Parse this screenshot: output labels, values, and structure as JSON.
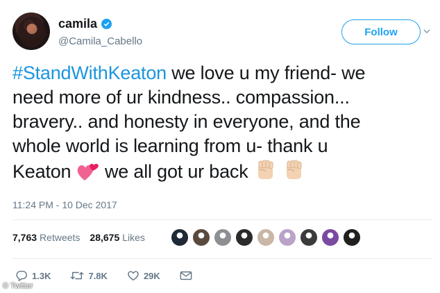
{
  "author": {
    "name": "camila",
    "handle": "@Camila_Cabello",
    "verified": true
  },
  "follow_button": {
    "label": "Follow"
  },
  "tweet": {
    "hashtag": "#StandWithKeaton",
    "line1_rest": " we love u my friend- we",
    "line2": "need more of ur kindness.. compassion...",
    "line3": "bravery.. and honesty in everyone, and the",
    "line4": "whole world is learning from u- thank u",
    "line5_a": "Keaton ",
    "line5_b": "we all got ur back",
    "emojis": [
      "two-hearts-emoji",
      "raised-fist-emoji",
      "raised-fist-emoji"
    ]
  },
  "timestamp": "11:24 PM - 10 Dec 2017",
  "stats": {
    "retweets_count": "7,763",
    "retweets_label": "Retweets",
    "likes_count": "28,675",
    "likes_label": "Likes"
  },
  "likers": [
    {
      "color": "#1f2a36"
    },
    {
      "color": "#5a4a3e"
    },
    {
      "color": "#8d8f92"
    },
    {
      "color": "#2b2b2b"
    },
    {
      "color": "#c9b6a6"
    },
    {
      "color": "#b9a3c9"
    },
    {
      "color": "#3b3b3b"
    },
    {
      "color": "#7a4aa0"
    },
    {
      "color": "#202020"
    }
  ],
  "actions": {
    "reply_count": "1.3K",
    "retweet_count": "7.8K",
    "like_count": "29K"
  },
  "watermark": "Twitter",
  "colors": {
    "accent": "#1da1f2",
    "hashtag": "#1b95e0",
    "muted": "#657786"
  }
}
